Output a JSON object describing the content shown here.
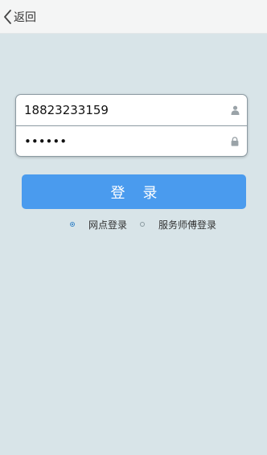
{
  "header": {
    "back_label": "返回"
  },
  "login_form": {
    "phone_value": "18823233159",
    "password_value": "••••••",
    "user_icon": "user-icon",
    "lock_icon": "lock-icon"
  },
  "login_button": {
    "label": "登录"
  },
  "login_type": {
    "options": [
      {
        "label": "网点登录",
        "selected": true
      },
      {
        "label": "服务师傅登录",
        "selected": false
      }
    ]
  },
  "colors": {
    "background": "#d8e4e8",
    "accent": "#4a9bee",
    "radio_selected": "#3a86c8"
  }
}
